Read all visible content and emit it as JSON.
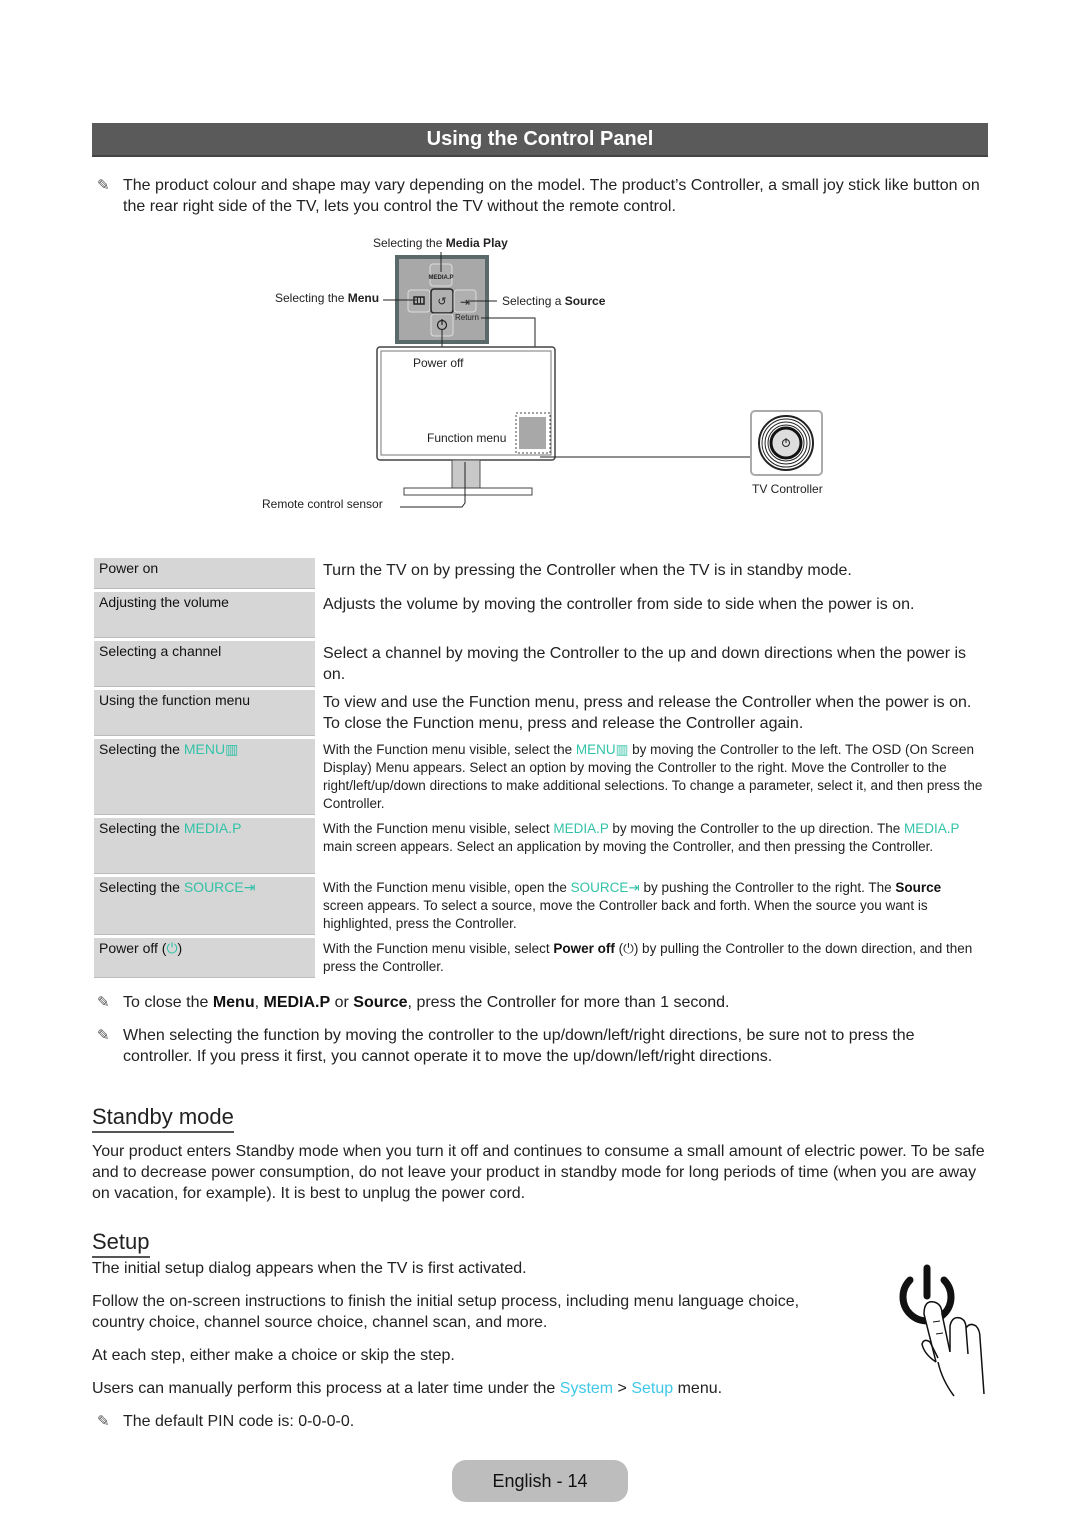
{
  "page_title": "Using the Control Panel",
  "intro_note": "The product colour and shape may vary depending on the model. The product’s Controller, a small joy stick like button on the rear right side of the TV, lets you control the TV without the remote control.",
  "diagram": {
    "media_play_label_prefix": "Selecting the ",
    "media_play_label_bold": "Media Play",
    "menu_label_prefix": "Selecting the ",
    "menu_label_bold": "Menu",
    "source_label_prefix": "Selecting a ",
    "source_label_bold": "Source",
    "media_button": "MEDIA.P",
    "return_label": "Return",
    "power_off_label": "Power off",
    "function_menu_label": "Function menu",
    "remote_sensor_label": "Remote control sensor",
    "tv_controller_label": "TV Controller",
    "icons": [
      "menu-icon",
      "return-icon",
      "source-icon",
      "power-icon"
    ]
  },
  "table": {
    "rows": [
      {
        "label": "Power on",
        "desc": "Turn the TV on by pressing the Controller when the TV is in standby mode."
      },
      {
        "label": "Adjusting the volume",
        "desc": "Adjusts the volume by moving the controller from side to side when the power is on."
      },
      {
        "label": "Selecting a channel",
        "desc": "Select a channel by moving the Controller to the up and down directions when the power is on."
      },
      {
        "label": "Using the function menu",
        "desc": "To view and use the Function menu, press and release the Controller when the power is on. To close the Function menu, press and release the Controller again."
      },
      {
        "label_prefix": "Selecting the ",
        "label_hl": "MENU",
        "desc_a": "With the Function menu visible, select the ",
        "desc_hl": "MENU",
        "desc_b": " by moving the Controller to the left. The OSD (On Screen Display) Menu appears. Select an option by moving the Controller to the right. Move the Controller to the right/left/up/down directions to make additional selections. To change a parameter, select it, and then press the Controller."
      },
      {
        "label_prefix": "Selecting the ",
        "label_hl": "MEDIA.P",
        "desc_a": "With the Function menu visible, select ",
        "desc_hl": "MEDIA.P",
        "desc_b": " by moving the Controller to the up direction. The ",
        "desc_hl2": "MEDIA.P",
        "desc_c": " main screen appears. Select an application by moving the Controller, and then pressing the Controller."
      },
      {
        "label_prefix": "Selecting the ",
        "label_hl": "SOURCE",
        "desc_a": "With the Function menu visible, open the ",
        "desc_hl": "SOURCE",
        "desc_b": " by pushing the Controller to the right. The ",
        "desc_bold": "Source",
        "desc_c": " screen appears. To select a source, move the Controller back and forth. When the source you want is highlighted, press the Controller."
      },
      {
        "label_prefix": "Power off (",
        "label_suffix": ")",
        "desc_a": "With the Function menu visible, select ",
        "desc_bold": "Power off",
        "desc_b": " (",
        "desc_c": ") by pulling the Controller to the down direction, and then press the Controller."
      }
    ]
  },
  "notes_after": [
    {
      "a": "To close the ",
      "b1": "Menu",
      "c": ", ",
      "b2": "MEDIA.P",
      "d": " or ",
      "b3": "Source",
      "e": ", press the Controller for more than 1 second."
    },
    {
      "text": "When selecting the function by moving the controller to the up/down/left/right directions, be sure not to press the controller. If you press it first, you cannot operate it to move the up/down/left/right directions."
    }
  ],
  "standby": {
    "heading": "Standby mode",
    "body": "Your product enters Standby mode when you turn it off and continues to consume a small amount of electric power. To be safe and to decrease power consumption, do not leave your product in standby mode for long periods of time (when you are away on vacation, for example). It is best to unplug the power cord."
  },
  "setup": {
    "heading": "Setup",
    "p1": "The initial setup dialog appears when the TV is first activated.",
    "p2": "Follow the on-screen instructions to finish the initial setup process, including menu language choice, country choice, channel source choice, channel scan, and more.",
    "p3": "At each step, either make a choice or skip the step.",
    "p4_a": "Users can manually perform this process at a later time under the ",
    "p4_link1": "System",
    "p4_sep": " > ",
    "p4_link2": "Setup",
    "p4_b": " menu.",
    "note": "The default PIN code is: 0-0-0-0."
  },
  "footer": "English - 14",
  "colors": {
    "accent_teal": "#33c2a8",
    "link_cyan": "#3fc7e8",
    "title_bar": "#5a5a5a"
  }
}
